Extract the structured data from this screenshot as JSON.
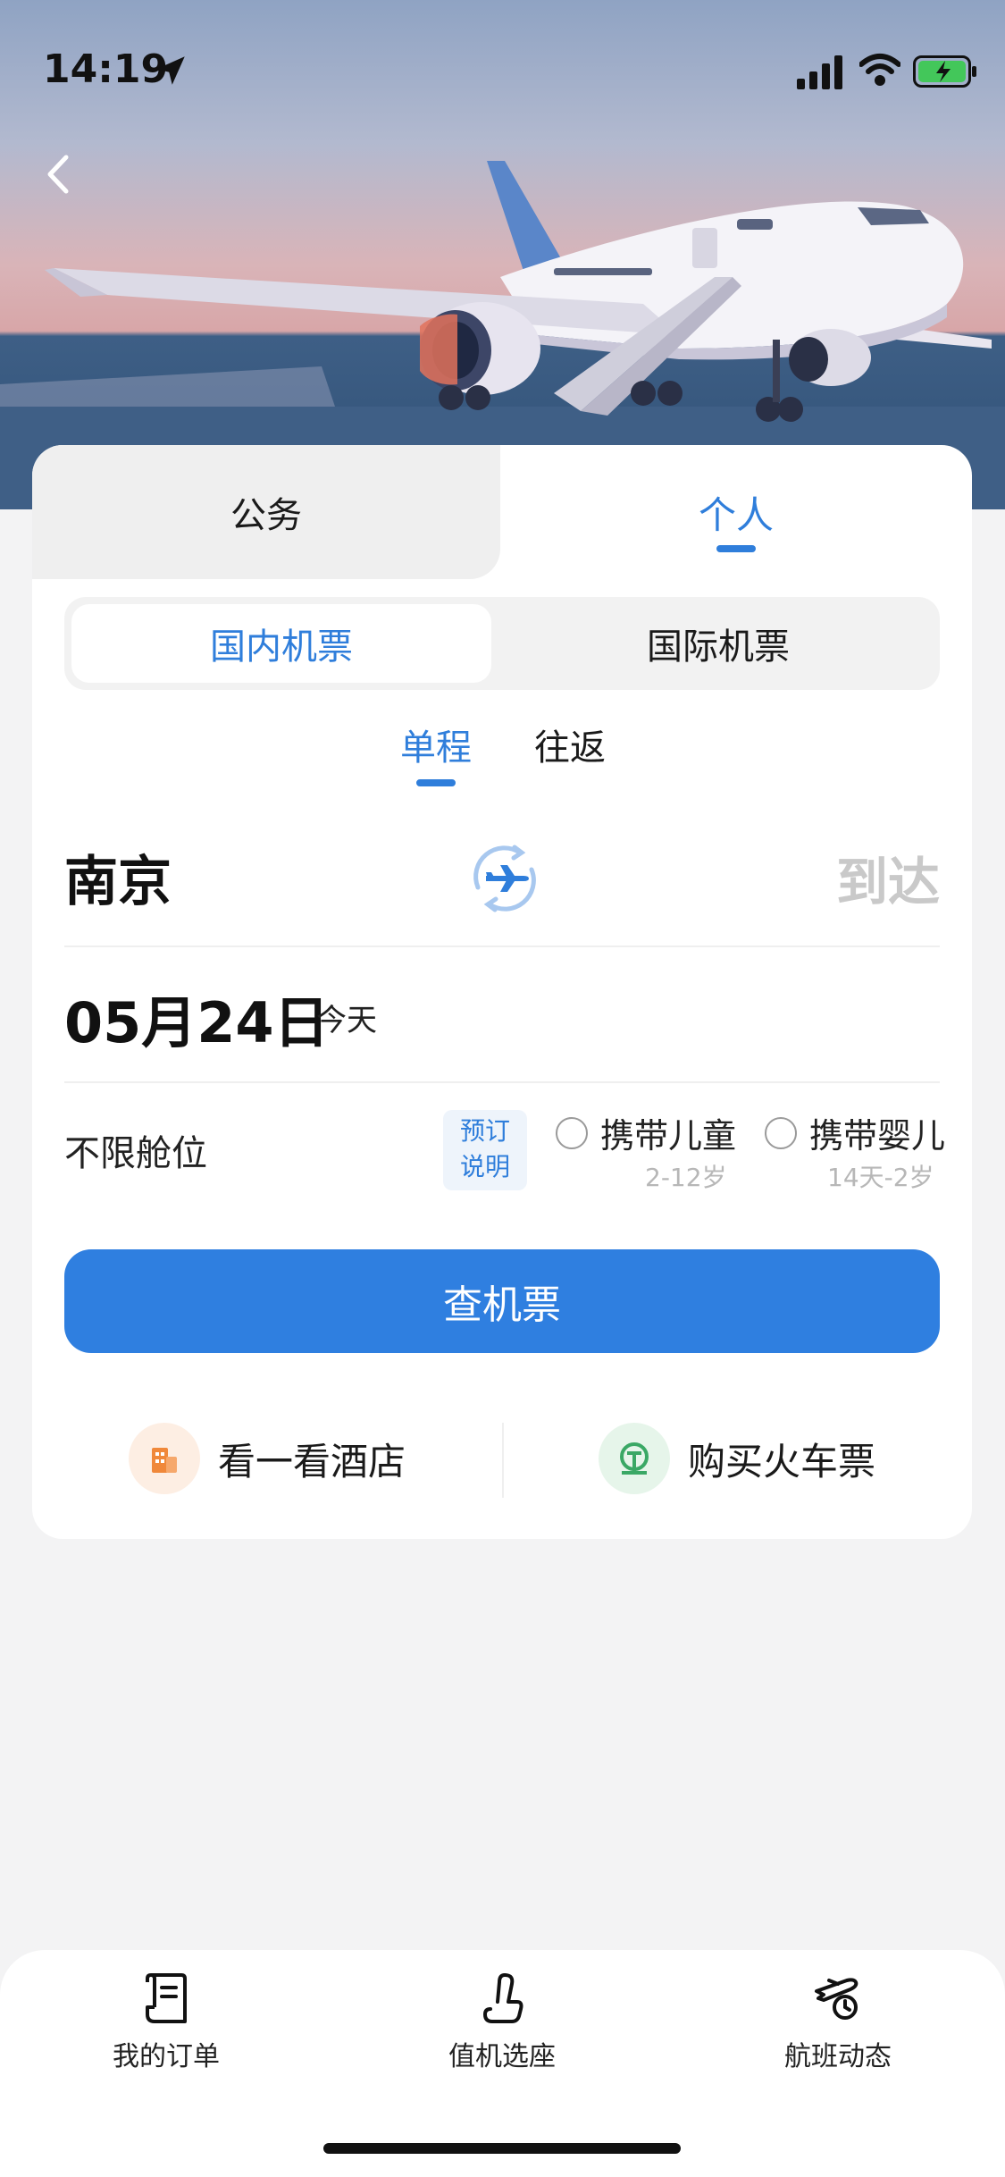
{
  "status_bar": {
    "time": "14:19"
  },
  "segment": {
    "business": "公务",
    "personal": "个人",
    "active": "personal"
  },
  "ticket_type": {
    "domestic": "国内机票",
    "international": "国际机票",
    "active": "domestic"
  },
  "trip": {
    "one_way": "单程",
    "round_trip": "往返",
    "active": "one_way"
  },
  "route": {
    "from": "南京",
    "to": "到达"
  },
  "date": {
    "value": "05月24日",
    "day_label": "今天"
  },
  "cabin": {
    "label": "不限舱位",
    "rules_line1": "预订",
    "rules_line2": "说明",
    "child_label": "携带儿童",
    "child_age": "2-12岁",
    "child_checked": false,
    "infant_label": "携带婴儿",
    "infant_age": "14天-2岁",
    "infant_checked": false
  },
  "search_button": "查机票",
  "quick_links": {
    "hotel": "看一看酒店",
    "train": "购买火车票"
  },
  "bottom_nav": {
    "orders": "我的订单",
    "checkin": "值机选座",
    "status": "航班动态"
  },
  "colors": {
    "accent": "#2f7edb",
    "button": "#2f7fe0",
    "hotel_icon": "#f0883a",
    "train_icon": "#3aa865"
  },
  "icons": [
    "back-arrow-icon",
    "location-arrow-icon",
    "signal-icon",
    "wifi-icon",
    "battery-icon",
    "swap-plane-icon",
    "hotel-icon",
    "train-icon",
    "order-icon",
    "seat-icon",
    "flight-status-icon"
  ]
}
